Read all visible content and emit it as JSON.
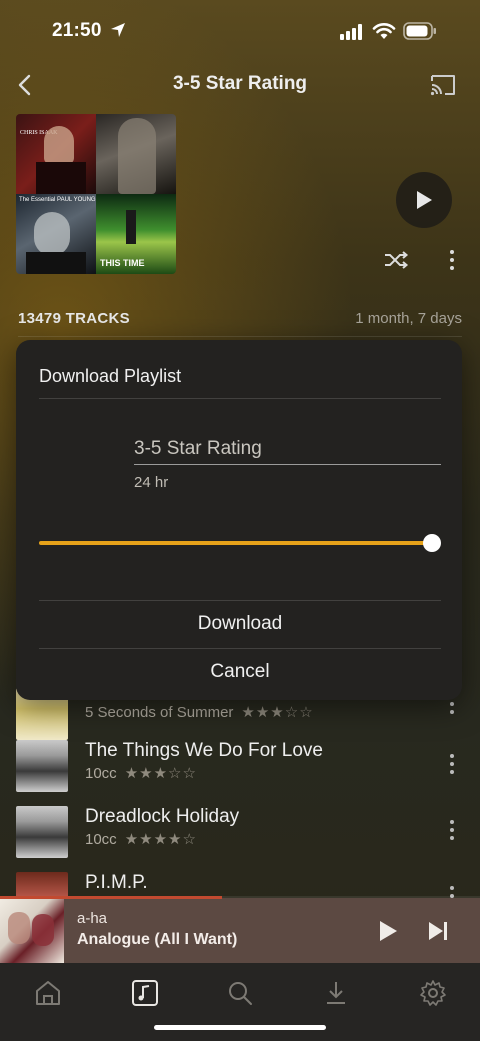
{
  "status_bar": {
    "time": "21:50"
  },
  "header": {
    "title": "3-5 Star Rating"
  },
  "cover": {
    "tile_1_text": "CHRIS ISAAK",
    "tile_3_text": "The Essential PAUL YOUNG",
    "tile_4_text": "THIS TIME"
  },
  "summary": {
    "tracks": "13479 TRACKS",
    "duration": "1 month, 7 days"
  },
  "dialog": {
    "title": "Download Playlist",
    "playlist_name": "3-5 Star Rating",
    "duration_label": "24 hr",
    "slider_value": 1.0,
    "download_label": "Download",
    "cancel_label": "Cancel"
  },
  "tracks": [
    {
      "title": "",
      "artist": "5 Seconds of Summer",
      "stars": "★★★☆☆"
    },
    {
      "title": "The Things We Do For Love",
      "artist": "10cc",
      "stars": "★★★☆☆"
    },
    {
      "title": "Dreadlock Holiday",
      "artist": "10cc",
      "stars": "★★★★☆"
    },
    {
      "title": "P.I.M.P.",
      "artist": "",
      "stars": ""
    }
  ],
  "now_playing": {
    "artist": "a-ha",
    "title": "Analogue (All I Want)",
    "progress": 0.46
  },
  "tabs": [
    "home",
    "library",
    "search",
    "downloads",
    "settings"
  ],
  "colors": {
    "accent": "#e6a21a",
    "progress": "#c24a30"
  }
}
